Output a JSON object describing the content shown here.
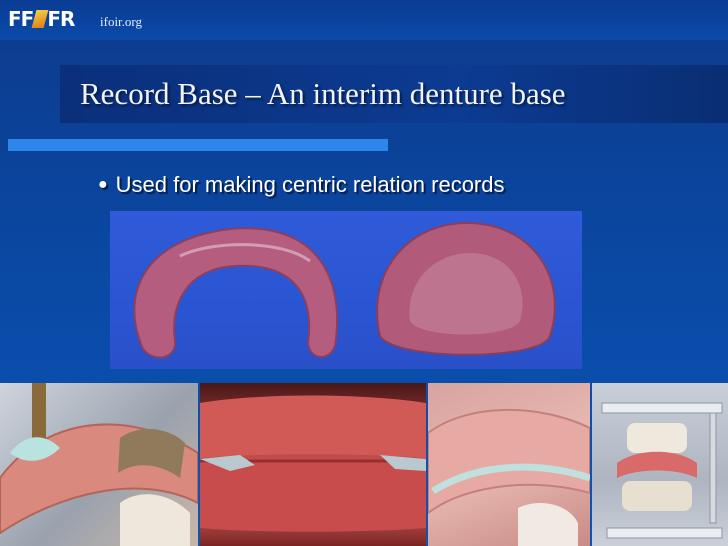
{
  "header": {
    "logo_text": "FF FR",
    "site": "ifoir.org"
  },
  "slide": {
    "title": "Record Base – An interim denture base",
    "bullets": [
      "Used for making centric relation records"
    ]
  },
  "colors": {
    "background": "#0a4aa6",
    "accent_bar": "#2f86ea",
    "title_band": "#0c3b92"
  },
  "images": [
    {
      "name": "record-bases-photo"
    },
    {
      "name": "wax-rim-photo"
    },
    {
      "name": "occlusal-rims-photo"
    },
    {
      "name": "bite-registration-photo"
    },
    {
      "name": "articulator-photo"
    }
  ]
}
